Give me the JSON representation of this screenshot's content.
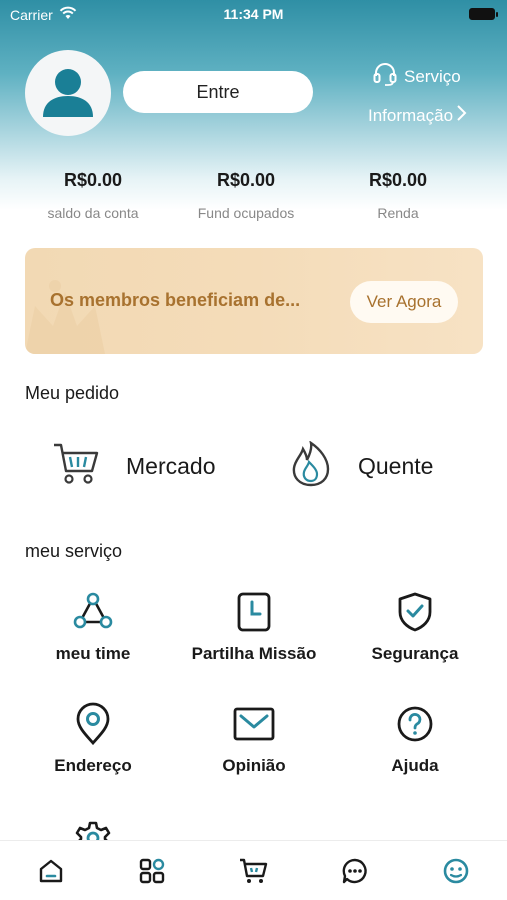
{
  "status_bar": {
    "carrier": "Carrier",
    "time": "11:34 PM"
  },
  "header": {
    "login_label": "Entre",
    "service_label": "Serviço",
    "info_label": "Informação"
  },
  "stats": [
    {
      "value": "R$0.00",
      "label": "saldo da conta"
    },
    {
      "value": "R$0.00",
      "label": "Fund ocupados"
    },
    {
      "value": "R$0.00",
      "label": "Renda"
    }
  ],
  "promo": {
    "text": "Os membros beneficiam de...",
    "button_label": "Ver Agora"
  },
  "orders": {
    "title": "Meu pedido",
    "items": [
      {
        "label": "Mercado",
        "icon": "cart-icon"
      },
      {
        "label": "Quente",
        "icon": "flame-icon"
      }
    ]
  },
  "services": {
    "title": "meu serviço",
    "items": [
      {
        "label": "meu time",
        "icon": "team-icon"
      },
      {
        "label": "Partilha Missão",
        "icon": "mission-icon"
      },
      {
        "label": "Segurança",
        "icon": "shield-icon"
      },
      {
        "label": "Endereço",
        "icon": "location-icon"
      },
      {
        "label": "Opinião",
        "icon": "mail-icon"
      },
      {
        "label": "Ajuda",
        "icon": "help-icon"
      },
      {
        "label": "",
        "icon": "settings-icon"
      }
    ]
  },
  "tabbar": {
    "items": [
      "home-icon",
      "apps-icon",
      "cart-icon",
      "chat-icon",
      "profile-icon"
    ],
    "active_index": 4
  },
  "colors": {
    "accent": "#2f8fa5",
    "promo_text": "#a8722f",
    "promo_bg": "#f2d9b4",
    "icon_teal": "#2a8aa0",
    "icon_dark": "#1a1a1a"
  }
}
